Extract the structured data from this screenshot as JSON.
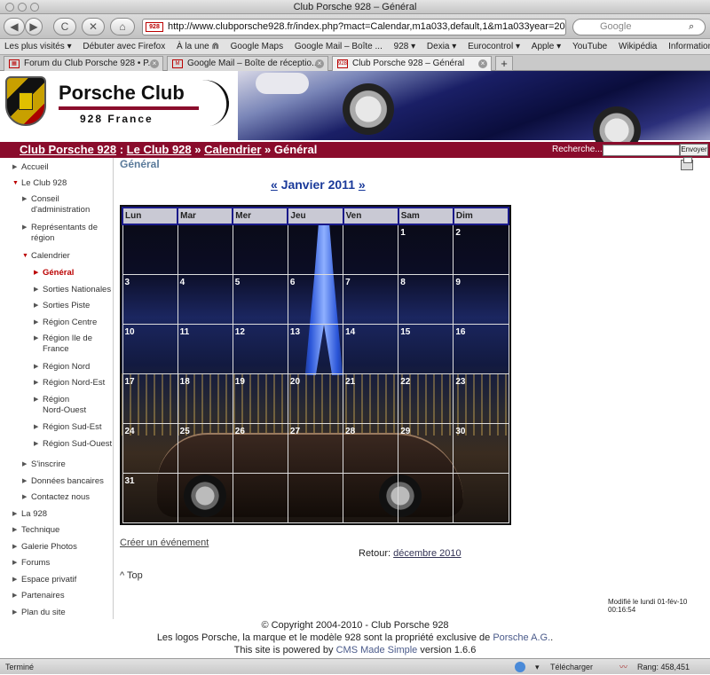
{
  "window": {
    "title": "Club Porsche 928 – Général"
  },
  "toolbar": {
    "back": "◀",
    "forward": "▶",
    "reload": "C",
    "stop": "✕",
    "home": "⌂",
    "url": "http://www.clubporsche928.fr/index.php?mact=Calendar,m1a033,default,1&m1a033year=201",
    "favicon_label": "928",
    "search_placeholder": "Google",
    "search_icon": "magnifier-icon"
  },
  "bookmarks": [
    "Les plus visités ▾",
    "Débuter avec Firefox",
    "À la une ⋒",
    "Google Maps",
    "Google Mail – Boîte ...",
    "928 ▾",
    "Dexia ▾",
    "Eurocontrol ▾",
    "Apple ▾",
    "YouTube",
    "Wikipédia",
    "Informations ▾"
  ],
  "tabs": [
    {
      "label": "Forum du Club Porsche 928 • P...",
      "fav": "▦"
    },
    {
      "label": "Google Mail – Boîte de réceptio...",
      "fav": "M"
    },
    {
      "label": "Club Porsche 928 – Général",
      "fav": "928"
    }
  ],
  "banner": {
    "club_name": "Porsche Club",
    "club_sub": "928 France"
  },
  "breadcrumb": {
    "c1": "Club Porsche 928",
    "sep1": " : ",
    "c2": "Le Club 928",
    "sep2": " » ",
    "c3": "Calendrier",
    "sep3": " » ",
    "c4": "Général"
  },
  "search": {
    "label": "Recherche...:",
    "button": "Envoyer"
  },
  "sidebar": {
    "accueil": "Accueil",
    "club": "Le Club 928",
    "conseil1": "Conseil",
    "conseil2": "d'administration",
    "rep1": "Représentants de",
    "rep2": "région",
    "calendrier": "Calendrier",
    "general": "Général",
    "nat": "Sorties Nationales",
    "piste": "Sorties Piste",
    "centre": "Région Centre",
    "idf1": "Région Ile de",
    "idf2": "France",
    "nord": "Région Nord",
    "ne": "Région Nord-Est",
    "no1": "Région",
    "no2": "Nord-Ouest",
    "se": "Région Sud-Est",
    "so": "Région Sud-Ouest",
    "inscrire": "S'inscrire",
    "donnees": "Données bancaires",
    "contact": "Contactez nous",
    "la928": "La 928",
    "technique": "Technique",
    "galerie": "Galerie Photos",
    "forums": "Forums",
    "espace": "Espace privatif",
    "partenaires": "Partenaires",
    "plan": "Plan du site"
  },
  "content": {
    "title": "Général",
    "prev": "«",
    "month": "Janvier 2011",
    "next": "»",
    "create_link": "Créer un événement",
    "retour_label": "Retour: ",
    "retour_link": "décembre 2010",
    "top": "^ Top",
    "modified": "Modifié le lundi 01-fév-10 00:16:54"
  },
  "calendar": {
    "days": [
      "Lun",
      "Mar",
      "Mer",
      "Jeu",
      "Ven",
      "Sam",
      "Dim"
    ],
    "weeks": [
      [
        "",
        "",
        "",
        "",
        "",
        "1",
        "2"
      ],
      [
        "3",
        "4",
        "5",
        "6",
        "7",
        "8",
        "9"
      ],
      [
        "10",
        "11",
        "12",
        "13",
        "14",
        "15",
        "16"
      ],
      [
        "17",
        "18",
        "19",
        "20",
        "21",
        "22",
        "23"
      ],
      [
        "24",
        "25",
        "26",
        "27",
        "28",
        "29",
        "30"
      ],
      [
        "31",
        "",
        "",
        "",
        "",
        "",
        ""
      ]
    ]
  },
  "footer": {
    "l1": "© Copyright 2004-2010 - Club Porsche 928",
    "l2a": "Les logos Porsche, la marque et le modèle 928 sont la propriété exclusive de ",
    "l2b": "Porsche A.G.",
    "l2c": ".",
    "l3a": "This site is powered by ",
    "l3b": "CMS Made Simple",
    "l3c": " version 1.6.6"
  },
  "status": {
    "text": "Terminé",
    "download": "Télécharger",
    "rank": "Rang: 458,451"
  }
}
